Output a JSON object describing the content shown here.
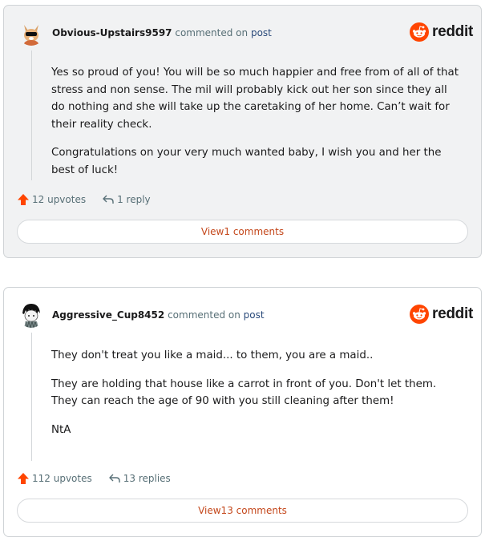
{
  "brand": {
    "wordmark": "reddit",
    "accent": "#ff4500"
  },
  "comments": [
    {
      "username": "Obvious-Upstairs9597",
      "verb": "commented on",
      "target": "post",
      "paragraphs": [
        "Yes so proud of you! You will be so much happier and free from of all of that stress and non sense. The mil will probably kick out her son since they all do nothing and she will take up the caretaking of her home. Can’t wait for their reality check.",
        "Congratulations on your very much wanted baby, I wish you and her the best of luck!"
      ],
      "upvotes": "12 upvotes",
      "replies": "1 reply",
      "view_label": "View1 comments"
    },
    {
      "username": "Aggressive_Cup8452",
      "verb": "commented on",
      "target": "post",
      "paragraphs": [
        "They don't treat you like a maid... to them, you are a maid..",
        "They are holding that house like a carrot in front of you. Don't let them. They can reach the age of 90 with you still cleaning after them!",
        "NtA"
      ],
      "upvotes": "112 upvotes",
      "replies": "13 replies",
      "view_label": "View13 comments"
    }
  ]
}
